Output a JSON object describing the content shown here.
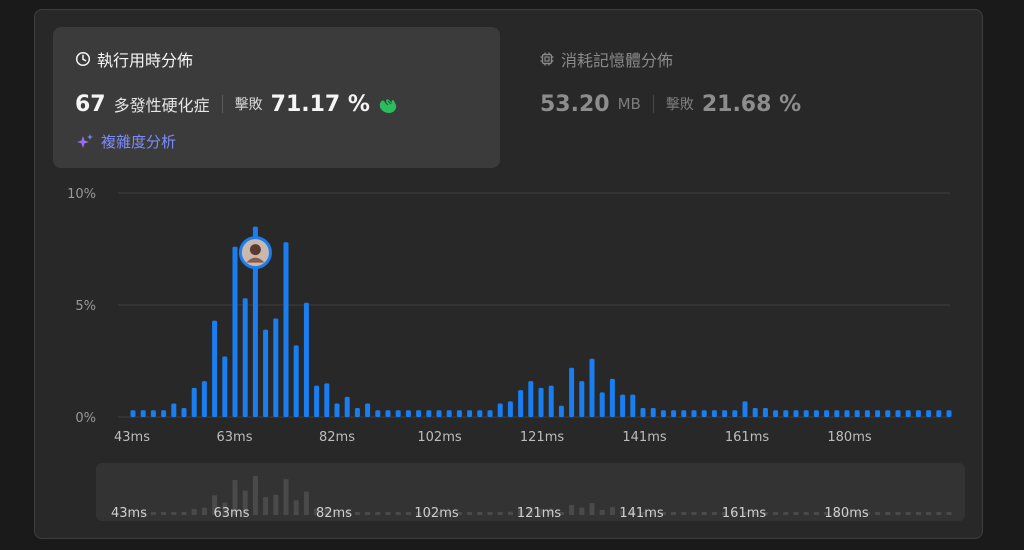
{
  "runtime": {
    "title": "執行用時分佈",
    "value": "67",
    "unit": "多發性硬化症",
    "beats_label": "擊敗",
    "beats_value": "71.17 %",
    "analysis_link": "複雜度分析"
  },
  "memory": {
    "title": "消耗記憶體分佈",
    "value": "53.20",
    "unit": "MB",
    "beats_label": "擊敗",
    "beats_value": "21.68 %"
  },
  "colors": {
    "bar": "#1a7ef1",
    "mini_bar": "#4a4a4a",
    "grid": "#3e3e3e",
    "accent": "#7c8cf7",
    "clap": "#2cbb5d"
  },
  "chart_data": {
    "type": "bar",
    "ylim": [
      0,
      10
    ],
    "y_ticks": [
      "10%",
      "5%",
      "0%"
    ],
    "x_tick_labels": [
      "43ms",
      "63ms",
      "82ms",
      "102ms",
      "121ms",
      "141ms",
      "161ms",
      "180ms"
    ],
    "marker_index": 12,
    "values": [
      0.3,
      0.3,
      0.3,
      0.3,
      0.6,
      0.4,
      1.3,
      1.6,
      4.3,
      2.7,
      7.6,
      5.3,
      8.5,
      3.9,
      4.4,
      7.8,
      3.2,
      5.1,
      1.4,
      1.5,
      0.6,
      0.9,
      0.4,
      0.6,
      0.3,
      0.3,
      0.3,
      0.3,
      0.3,
      0.3,
      0.3,
      0.3,
      0.3,
      0.3,
      0.3,
      0.3,
      0.6,
      0.7,
      1.2,
      1.6,
      1.3,
      1.4,
      0.5,
      2.2,
      1.6,
      2.6,
      1.1,
      1.7,
      1.0,
      1.0,
      0.4,
      0.4,
      0.3,
      0.3,
      0.3,
      0.3,
      0.3,
      0.3,
      0.3,
      0.3,
      0.7,
      0.4,
      0.4,
      0.3,
      0.3,
      0.3,
      0.3,
      0.3,
      0.3,
      0.3,
      0.3,
      0.3,
      0.3,
      0.3,
      0.3,
      0.3,
      0.3,
      0.3,
      0.3,
      0.3,
      0.3
    ]
  }
}
